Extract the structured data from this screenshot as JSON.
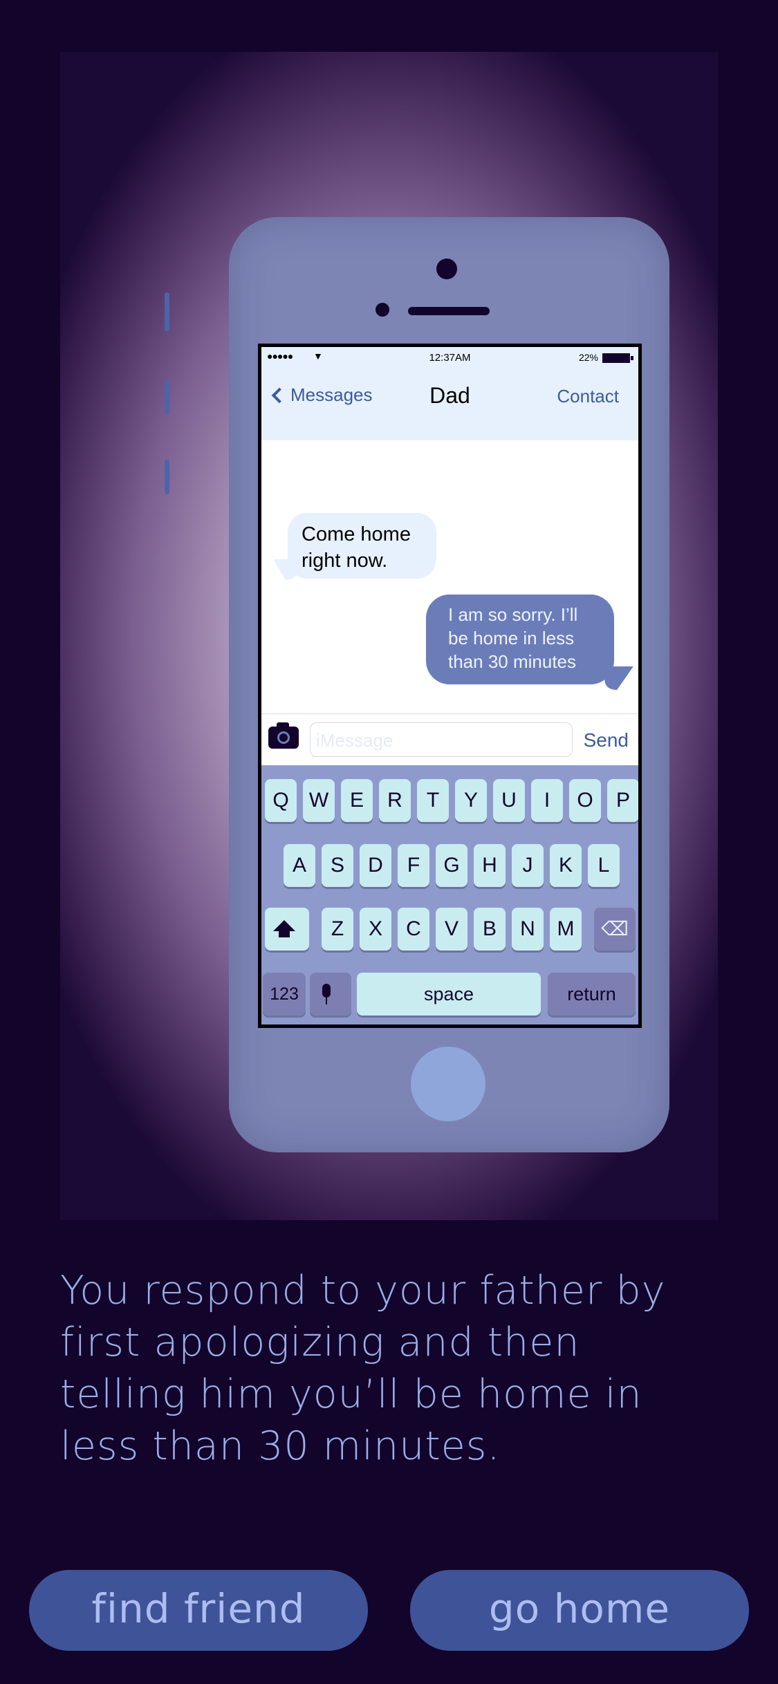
{
  "phone": {
    "status": {
      "signal": "●●●●●",
      "wifi": "▼",
      "time": "12:37AM",
      "battery": "22%"
    },
    "nav": {
      "back_label": "Messages",
      "title": "Dad",
      "contact_label": "Contact"
    },
    "messages": [
      {
        "direction": "incoming",
        "lines": [
          "Come home",
          "right now."
        ]
      },
      {
        "direction": "outgoing",
        "lines": [
          "I am so sorry. I’ll",
          "be home in less",
          "than 30 minutes"
        ]
      }
    ],
    "input": {
      "placeholder": "iMessage",
      "send_label": "Send"
    },
    "keyboard": {
      "row1": [
        "Q",
        "W",
        "E",
        "R",
        "T",
        "Y",
        "U",
        "I",
        "O",
        "P"
      ],
      "row2": [
        "A",
        "S",
        "D",
        "F",
        "G",
        "H",
        "J",
        "K",
        "L"
      ],
      "row3": [
        "Z",
        "X",
        "C",
        "V",
        "B",
        "N",
        "M"
      ],
      "numbers_label": "123",
      "space_label": "space",
      "return_label": "return",
      "delete_glyph": "⌫"
    }
  },
  "story": {
    "text": "You respond to your father by first apologizing and then telling him you’ll be home in less than 30 minutes."
  },
  "choices": {
    "left": "find friend",
    "right": "go home"
  }
}
